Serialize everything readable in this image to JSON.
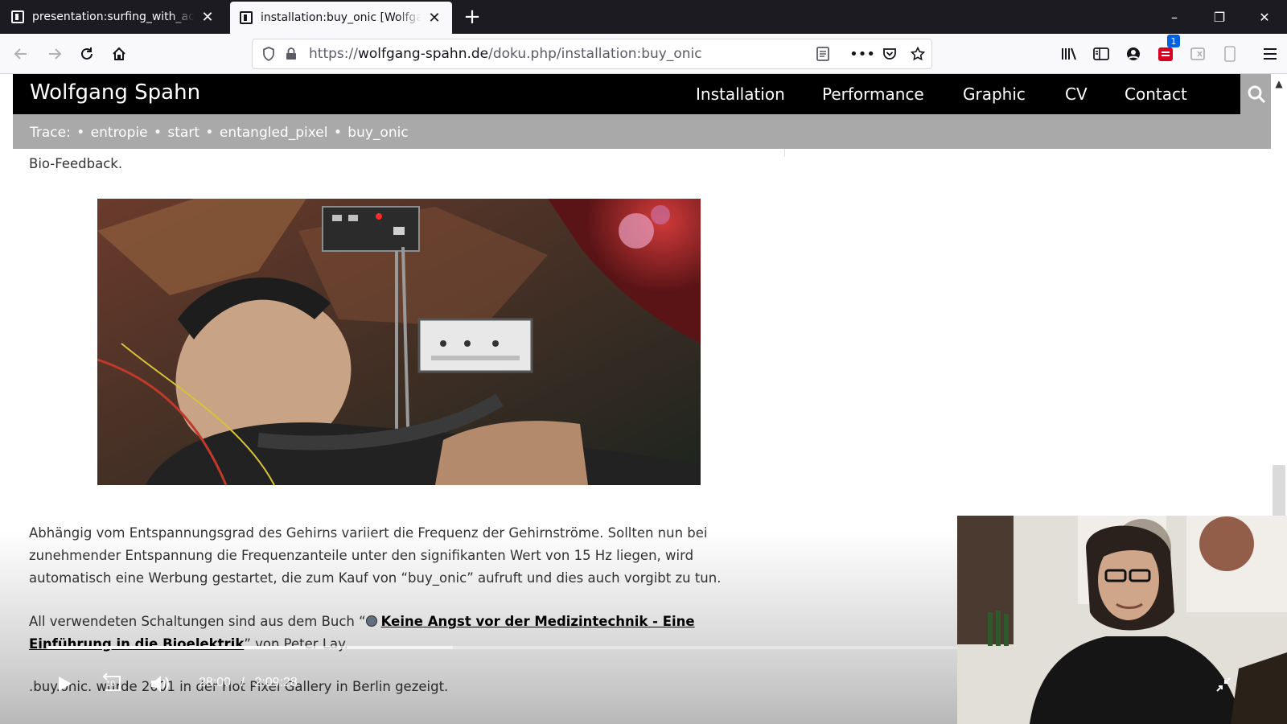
{
  "browser": {
    "tabs": [
      {
        "title": "presentation:surfing_with_aci_f",
        "active": false
      },
      {
        "title": "installation:buy_onic [Wolfgang",
        "active": true
      }
    ],
    "new_tab_symbol": "+",
    "window_controls": {
      "minimize": "–",
      "restore": "❐",
      "close": "✕"
    },
    "url": {
      "scheme": "https://",
      "host": "wolfgang-spahn.de",
      "path": "/doku.php/installation:buy_onic"
    },
    "notification_badge": "1"
  },
  "site": {
    "title": "Wolfgang Spahn",
    "nav": [
      "Installation",
      "Performance",
      "Graphic",
      "CV",
      "Contact"
    ],
    "trace_label": "Trace:",
    "trace_items": [
      "entropie",
      "start",
      "entangled_pixel",
      "buy_onic"
    ],
    "bullet": "•"
  },
  "content": {
    "line_top": "Bio-Feedback.",
    "para1": "Abhängig vom Entspannungsgrad des Gehirns variiert die Frequenz der Gehirnströme. Sollten nun bei zunehmender Entspannung die Frequenzanteile unter den signifikanten Wert von 15 Hz liegen, wird automatisch eine Werbung gestartet, die zum Kauf von “buy_onic” aufruft und dies auch vorgibt zu tun.",
    "para2_prefix": "All verwendeten Schaltungen sind aus dem Buch “",
    "para2_link": "Keine Angst vor der Medizintechnik - Eine Einführung in die Bioelektrik",
    "para2_suffix": "” von Peter Lay.",
    "para3": ".buy.onic. wurde 2001 in der Hot Pixel Gallery in Berlin gezeigt."
  },
  "video": {
    "current_time": "28:00",
    "separator": "/",
    "duration": "2:09:28",
    "progress_fraction": 0.216,
    "buffered_fraction": 0.34,
    "replay_label": "10"
  },
  "colors": {
    "tabstrip": "#1c1b22",
    "toolbar": "#f9f9fb",
    "site_header": "#000000",
    "trace_bar": "#a9a9a9"
  }
}
